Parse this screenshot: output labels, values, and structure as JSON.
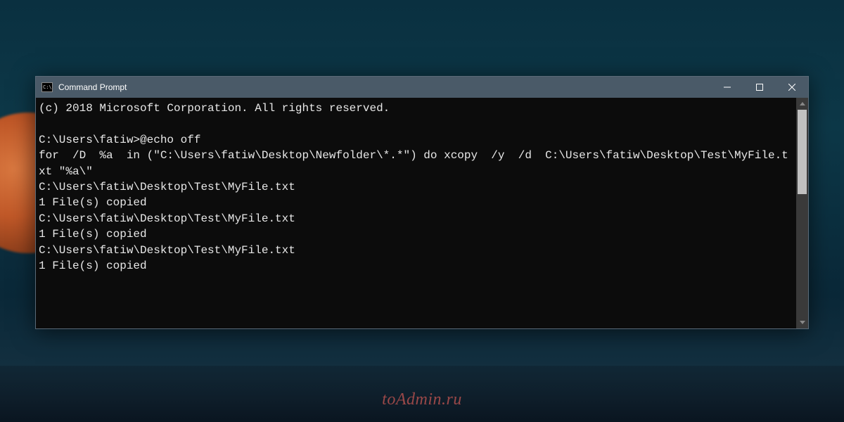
{
  "window": {
    "title": "Command Prompt",
    "icon_label": "C:\\"
  },
  "terminal": {
    "lines": [
      "(c) 2018 Microsoft Corporation. All rights reserved.",
      "",
      "C:\\Users\\fatiw>@echo off",
      "for  /D  %a  in (\"C:\\Users\\fatiw\\Desktop\\Newfolder\\*.*\") do xcopy  /y  /d  C:\\Users\\fatiw\\Desktop\\Test\\MyFile.txt \"%a\\\"",
      "C:\\Users\\fatiw\\Desktop\\Test\\MyFile.txt",
      "1 File(s) copied",
      "C:\\Users\\fatiw\\Desktop\\Test\\MyFile.txt",
      "1 File(s) copied",
      "C:\\Users\\fatiw\\Desktop\\Test\\MyFile.txt",
      "1 File(s) copied"
    ]
  },
  "watermark": "toAdmin.ru"
}
